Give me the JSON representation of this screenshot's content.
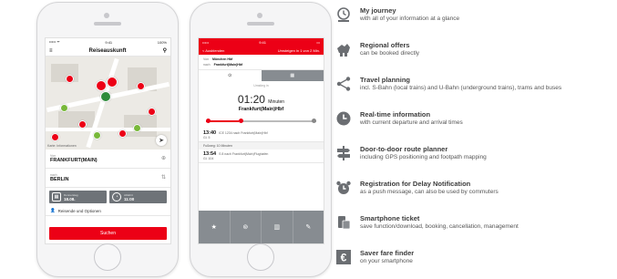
{
  "phone_left": {
    "status_time": "9:41",
    "status_carrier": "••••• ᯤ",
    "status_battery": "100%",
    "title": "Reiseauskunft",
    "map_copyright": "Karte: Informationen",
    "from_label": "Von",
    "from_value": "FRANKFURT(MAIN)",
    "to_label": "nach",
    "to_value": "BERLIN",
    "date_label": "Donnerstag",
    "date_value": "18.08.",
    "time_label": "Abfahrt",
    "time_value": "11:00",
    "options_label": "Reisende und Optionen",
    "search_button": "Suchen"
  },
  "phone_right": {
    "status_time": "9:41",
    "back_label": "< Ausblenden",
    "header_right": "Umsteigen in 1 von 2 Min.",
    "from_label": "Von",
    "from_value": "München Hbf",
    "to_label": "nach",
    "to_value": "Frankfurt(Main)Hbf",
    "umstieg_label": "Umstieg in",
    "countdown": "01:20",
    "countdown_unit": "Minuten",
    "destination": "Frankfurt(Main)Hbf",
    "conn1_time": "13:40",
    "conn1_desc": "ICE 1234 nach Frankfurt(Main)Hbf",
    "conn1_sub": "Gl. 5",
    "walk_label": "Fußweg: 10 Minuten",
    "conn2_time": "13:54",
    "conn2_desc": "S 8 nach Frankfurt(Main)Flughafen",
    "conn2_sub": "Gl. 104"
  },
  "features": [
    {
      "icon": "journey-clock-icon",
      "title": "My journey",
      "desc": "with all of your information at a glance"
    },
    {
      "icon": "regional-offers-icon",
      "title": "Regional offers",
      "desc": "can be booked directly"
    },
    {
      "icon": "share-network-icon",
      "title": "Travel planning",
      "desc": "incl. S-Bahn (local trains) and U-Bahn (underground trains), trams and buses"
    },
    {
      "icon": "realtime-clock-icon",
      "title": "Real-time information",
      "desc": "with current departure and arrival times"
    },
    {
      "icon": "signpost-icon",
      "title": "Door-to-door route planner",
      "desc": "including GPS positioning and footpath mapping"
    },
    {
      "icon": "alarm-clock-icon",
      "title": "Registration for Delay Notification",
      "desc": "as a push message, can also be used by commuters"
    },
    {
      "icon": "smartphone-ticket-icon",
      "title": "Smartphone ticket",
      "desc": "save function/download, booking, cancellation, management"
    },
    {
      "icon": "euro-icon",
      "title": "Saver fare finder",
      "desc": "on your smartphone"
    }
  ],
  "colors": {
    "brand_red": "#ec0016",
    "icon_grey": "#6b6e72",
    "bar_grey": "#878c91"
  }
}
